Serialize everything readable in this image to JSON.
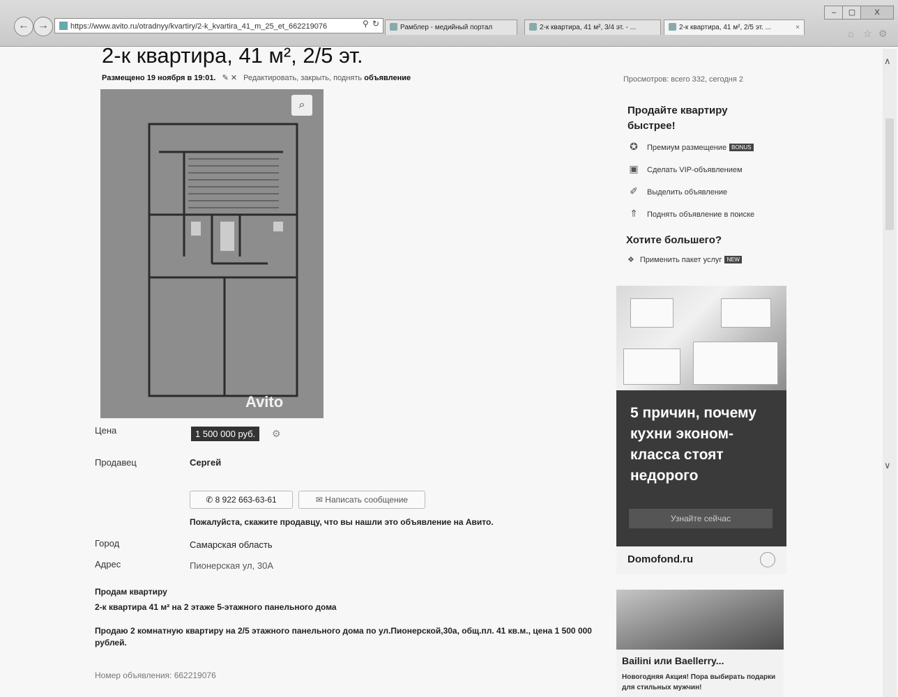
{
  "browser": {
    "address_url": "https://www.avito.ru/otradnyy/kvartiry/2-k_kvartira_41_m_25_et_662219076",
    "tabs": [
      {
        "label": "Рамблер - медийный портал"
      },
      {
        "label": "2-к квартира, 41 м², 3/4 эт. - ..."
      },
      {
        "label": "2-к квартира, 41 м², 2/5 эт. ..."
      }
    ],
    "window_buttons": {
      "minimize": "–",
      "maximize": "▢",
      "close": "X"
    }
  },
  "listing": {
    "title": "2-к квартира, 41 м², 2/5 эт.",
    "posted": "Размещено 19 ноября в 19:01.",
    "edit_links": "Редактировать, закрыть, поднять",
    "edit_word": "объявление",
    "photo_watermark": "Avito",
    "price_label": "Цена",
    "price": "1 500 000 руб.",
    "seller_label": "Продавец",
    "seller_name": "Сергей",
    "phone": "8 922 663-63-61",
    "message_button": "Написать сообщение",
    "hint": "Пожалуйста, скажите продавцу, что вы нашли это объявление на Авито.",
    "city_label": "Город",
    "city": "Самарская область",
    "address_label": "Адрес",
    "address": "Пионерская ул, 30А",
    "description_heading": "Продам квартиру",
    "description_line1": "2-к квартира 41 м² на 2 этаже 5-этажного панельного дома",
    "description_body": "Продаю 2 комнатную квартиру на 2/5 этажного панельного дома по ул.Пионерской,30а, общ.пл. 41 кв.м., цена 1 500 000 рублей.",
    "ad_number": "Номер объявления: 662219076"
  },
  "sidebar": {
    "views": "Просмотров: всего 332, сегодня 2",
    "promo_title": "Продайте квартиру быстрее!",
    "promo_items": [
      {
        "label": "Премиум размещение",
        "badge": "BONUS",
        "icon": "premium-icon"
      },
      {
        "label": "Сделать VIP-объявлением",
        "icon": "vip-icon"
      },
      {
        "label": "Выделить объявление",
        "icon": "highlight-icon"
      },
      {
        "label": "Поднять объявление в поиске",
        "icon": "raise-icon"
      }
    ],
    "more_title": "Хотите большего?",
    "package": {
      "label": "Применить пакет услуг",
      "badge": "NEW"
    }
  },
  "ads": {
    "ad1": {
      "headline": "5 причин, почему кухни эконом-класса стоят недорого",
      "button": "Узнайте сейчас",
      "brand": "Domofond.ru"
    },
    "ad2": {
      "title": "Bailini или Baellerry...",
      "text": "Новогодняя Акция! Пора выбирать подарки для стильных мужчин!"
    }
  }
}
